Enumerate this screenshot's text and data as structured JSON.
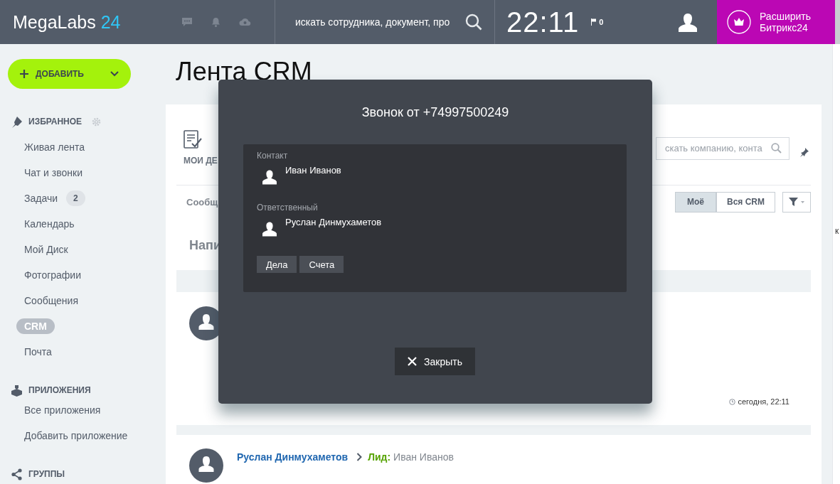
{
  "header": {
    "logo": {
      "text": "MegaLabs",
      "accent": "24"
    },
    "search": {
      "placeholder": "искать сотрудника, документ, про"
    },
    "clock": "22:11",
    "flag_count": "0",
    "upgrade_button": {
      "lines": [
        "Расширить",
        "Битрикс24"
      ]
    }
  },
  "sidebar": {
    "add_button": "ДОБАВИТЬ",
    "sections": [
      {
        "title": "ИЗБРАННОЕ",
        "items": [
          {
            "label": "Живая лента",
            "selected": false
          },
          {
            "label": "Чат и звонки",
            "selected": false
          },
          {
            "label": "Задачи",
            "selected": false,
            "badge": "2"
          },
          {
            "label": "Календарь",
            "selected": false
          },
          {
            "label": "Мой Диск",
            "selected": false
          },
          {
            "label": "Фотографии",
            "selected": false
          },
          {
            "label": "Сообщения",
            "selected": false
          },
          {
            "label": "CRM",
            "selected": true
          },
          {
            "label": "Почта",
            "selected": false
          }
        ]
      },
      {
        "title": "ПРИЛОЖЕНИЯ",
        "items": [
          {
            "label": "Все приложения",
            "selected": false
          },
          {
            "label": "Добавить приложение",
            "selected": false
          }
        ]
      },
      {
        "title": "ГРУППЫ"
      }
    ]
  },
  "page_title": "Лента CRM",
  "toolbar": {
    "my_activities_label": "МОИ ДЕ",
    "search": {
      "placeholder": "скать компанию, конта"
    }
  },
  "filter": {
    "tab_label": "Сообщ",
    "scope_buttons": [
      {
        "label": "Моё",
        "selected": true
      },
      {
        "label": "Вся CRM",
        "selected": false
      }
    ]
  },
  "section_heading": "Напи",
  "posts": [
    {
      "timestamp": "сегодня, 22:11"
    },
    {
      "author": "Руслан Динмухаметов",
      "entity_type": "Лид:",
      "entity_name": "Иван Иванов"
    }
  ],
  "right_edge_text": "к",
  "modal": {
    "title": "Звонок от +74997500249",
    "fields": [
      {
        "label": "Контакт",
        "value": "Иван Иванов"
      },
      {
        "label": "Ответственный",
        "value": "Руслан Динмухаметов"
      }
    ],
    "buttons": [
      "Дела",
      "Счета"
    ],
    "close_button": "Закрыть"
  }
}
